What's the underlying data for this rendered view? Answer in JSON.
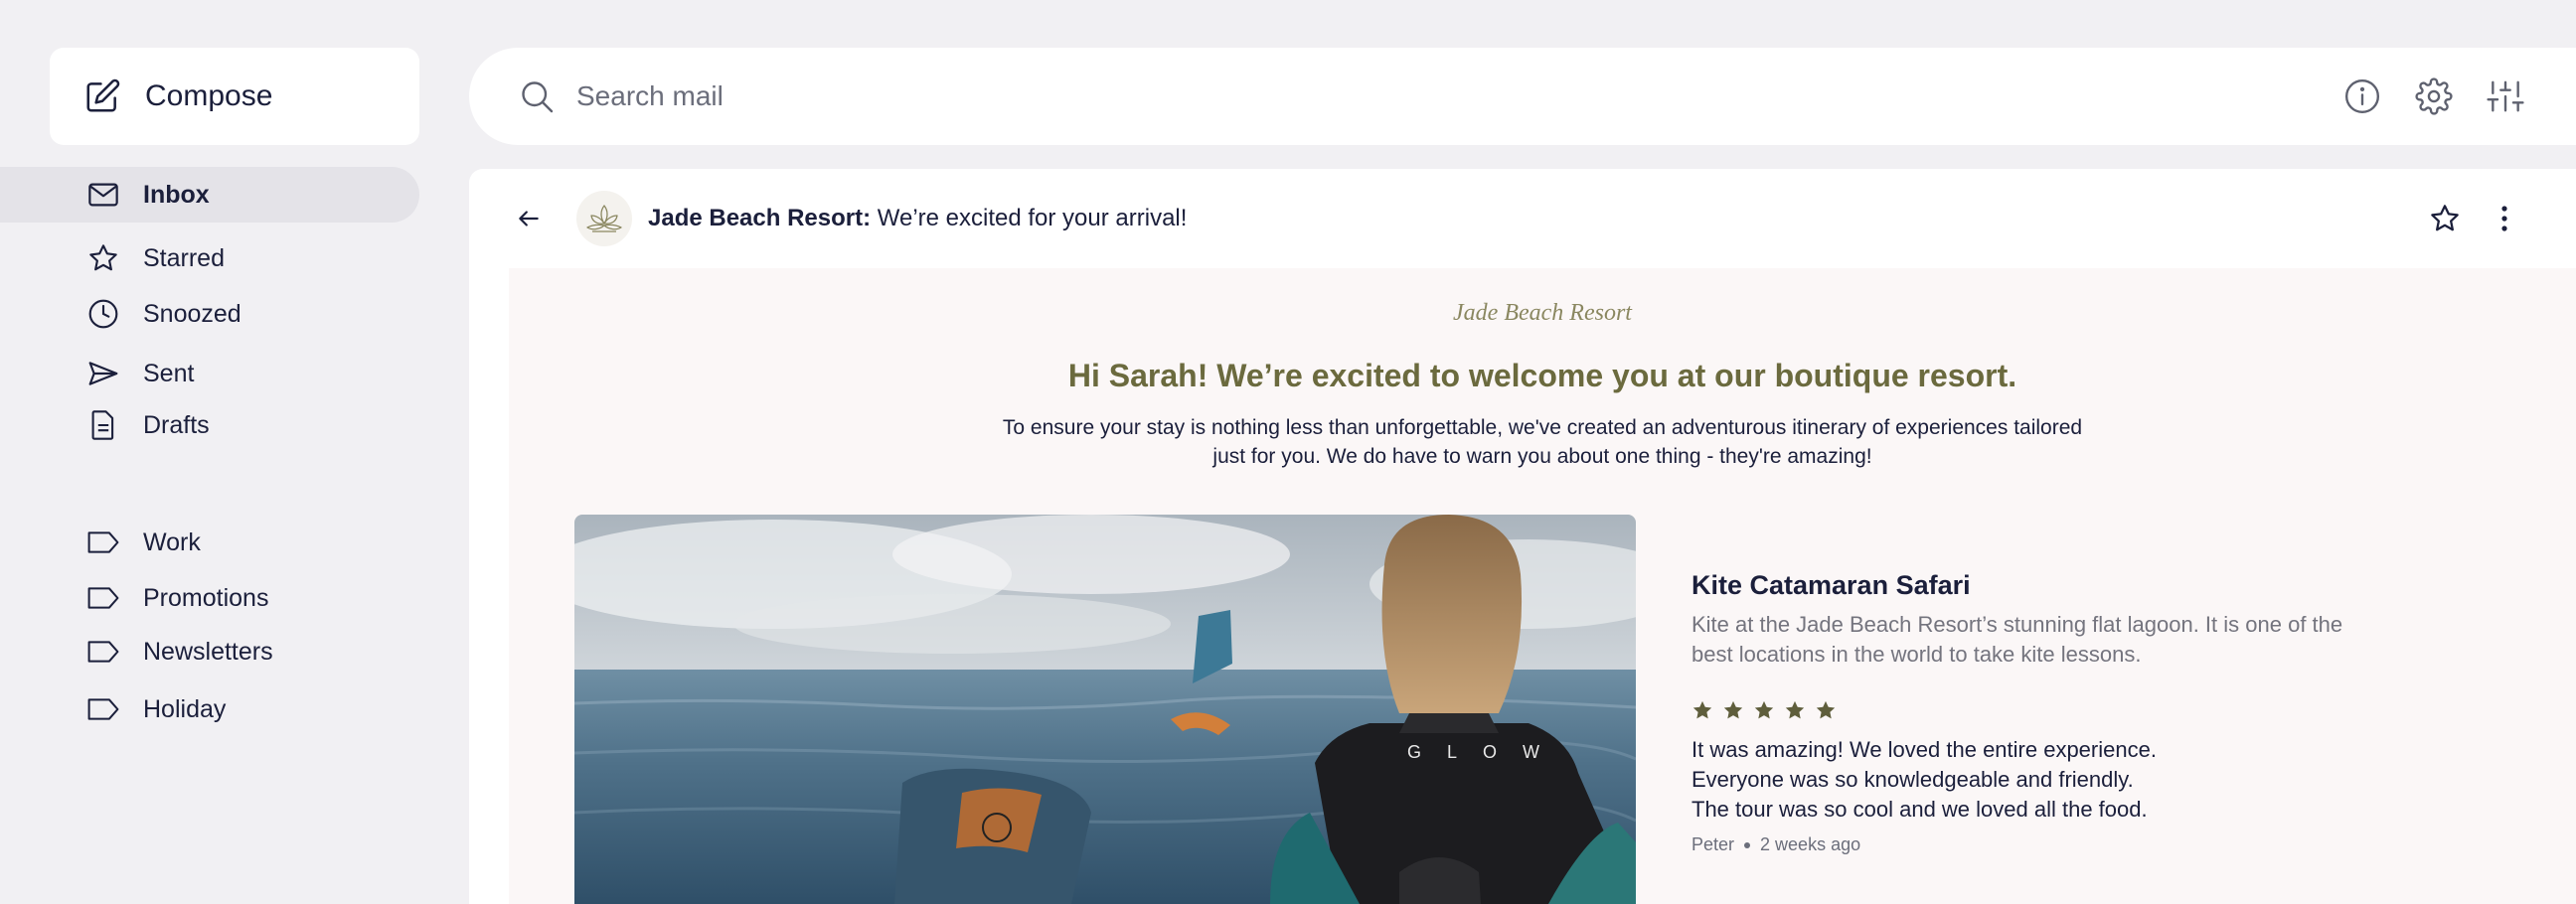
{
  "sidebar": {
    "compose_label": "Compose",
    "items": [
      {
        "label": "Inbox",
        "icon": "mail-icon",
        "active": true
      },
      {
        "label": "Starred",
        "icon": "star-icon"
      },
      {
        "label": "Snoozed",
        "icon": "clock-icon"
      },
      {
        "label": "Sent",
        "icon": "send-icon"
      },
      {
        "label": "Drafts",
        "icon": "draft-icon"
      }
    ],
    "labels": [
      {
        "label": "Work",
        "icon": "label-icon"
      },
      {
        "label": "Promotions",
        "icon": "label-icon"
      },
      {
        "label": "Newsletters",
        "icon": "label-icon"
      },
      {
        "label": "Holiday",
        "icon": "label-icon"
      }
    ]
  },
  "search": {
    "placeholder": "Search mail",
    "icons": [
      "info-icon",
      "gear-icon",
      "sliders-icon"
    ]
  },
  "email": {
    "sender": "Jade Beach Resort:",
    "subject": "We’re excited for your arrival!",
    "brand": "Jade Beach Resort",
    "headline": "Hi Sarah! We’re excited to welcome you at our boutique resort.",
    "intro": "To ensure your stay is nothing less than unforgettable, we've created an adventurous itinerary of experiences tailored just for you. We do have to warn you about one thing - they're amazing!",
    "tour": {
      "title": "Kite Catamaran Safari",
      "description": "Kite at the Jade Beach Resort’s stunning flat lagoon. It is one of the best locations in the world to take kite lessons.",
      "rating": 5,
      "review_lines": [
        "It was amazing! We loved the entire experience.",
        "Everyone was so knowledgeable and friendly.",
        "The tour was so cool and we loved all the food."
      ],
      "reviewer": "Peter",
      "review_time": "2 weeks ago"
    }
  },
  "colors": {
    "accent_olive": "#6b6a3e",
    "star": "#5f5e3c",
    "background": "#f1f0f3",
    "email_bg": "#fbf7f7"
  }
}
